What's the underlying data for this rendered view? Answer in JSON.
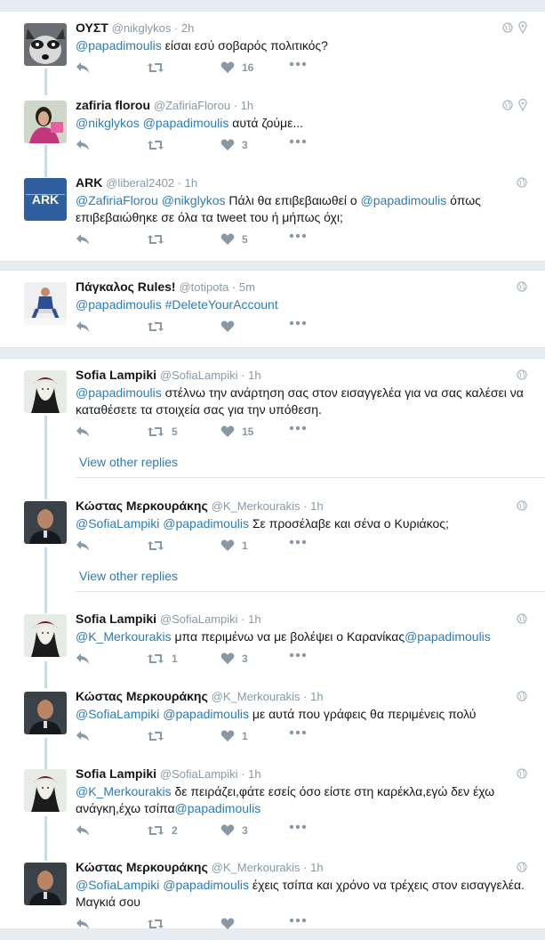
{
  "threads": [
    {
      "tweets": [
        {
          "name": "ΟΥΣΤ",
          "handle": "@nikglykos",
          "time": "2h",
          "body": [
            {
              "t": "@papadimoulis",
              "m": true
            },
            {
              "t": " είσαι εσύ σοβαρός πολιτικός?",
              "m": false
            }
          ],
          "retweets": "",
          "likes": "16",
          "avatar": "raccoon"
        },
        {
          "name": "zafiria florou",
          "handle": "@ZafiriaFlorou",
          "time": "1h",
          "body": [
            {
              "t": "@nikglykos",
              "m": true
            },
            {
              "t": " ",
              "m": false
            },
            {
              "t": "@papadimoulis",
              "m": true
            },
            {
              "t": " αυτά ζούμε...",
              "m": false
            }
          ],
          "retweets": "",
          "likes": "3",
          "avatar": "woman-pink"
        },
        {
          "name": "ARK",
          "handle": "@liberal2402",
          "time": "1h",
          "body": [
            {
              "t": "@ZafiriaFlorou",
              "m": true
            },
            {
              "t": " ",
              "m": false
            },
            {
              "t": "@nikglykos",
              "m": true
            },
            {
              "t": " Πάλι θα επιβεβαιωθεί ο ",
              "m": false
            },
            {
              "t": "@papadimoulis",
              "m": true
            },
            {
              "t": " όπως επιβεβαιώθηκε σε όλα τα tweet του ή μήπως όχι;",
              "m": false
            }
          ],
          "retweets": "",
          "likes": "5",
          "avatar": "ark"
        }
      ]
    },
    {
      "tweets": [
        {
          "name": "Πάγκαλος Rules!",
          "handle": "@totipota",
          "time": "5m",
          "body": [
            {
              "t": "@papadimoulis",
              "m": true
            },
            {
              "t": " ",
              "m": false
            },
            {
              "t": "#DeleteYourAccount",
              "m": true
            }
          ],
          "retweets": "",
          "likes": "",
          "avatar": "man-sitting"
        }
      ]
    },
    {
      "tweets": [
        {
          "name": "Sofia Lampiki",
          "handle": "@SofiaLampiki",
          "time": "1h",
          "body": [
            {
              "t": "@papadimoulis",
              "m": true
            },
            {
              "t": " στέλνω την ανάρτηση σας στον εισαγγελέα για να σας καλέσει να καταθέσετε τα στοιχεία σας για την υπόθεση.",
              "m": false
            }
          ],
          "retweets": "5",
          "likes": "15",
          "avatar": "sofia"
        },
        {
          "name": "Κώστας Μερκουράκης",
          "handle": "@K_Merkourakis",
          "time": "1h",
          "body": [
            {
              "t": "@SofiaLampiki",
              "m": true
            },
            {
              "t": " ",
              "m": false
            },
            {
              "t": "@papadimoulis",
              "m": true
            },
            {
              "t": " Σε προσέλαβε και σένα ο Κυριάκος;",
              "m": false
            }
          ],
          "retweets": "",
          "likes": "1",
          "avatar": "kostas"
        },
        {
          "name": "Sofia Lampiki",
          "handle": "@SofiaLampiki",
          "time": "1h",
          "body": [
            {
              "t": "@K_Merkourakis",
              "m": true
            },
            {
              "t": " μπα περιμένω να με βολέψει ο Καρανίκας",
              "m": false
            },
            {
              "t": "@papadimoulis",
              "m": true
            }
          ],
          "retweets": "1",
          "likes": "3",
          "avatar": "sofia"
        },
        {
          "name": "Κώστας Μερκουράκης",
          "handle": "@K_Merkourakis",
          "time": "1h",
          "body": [
            {
              "t": "@SofiaLampiki",
              "m": true
            },
            {
              "t": " ",
              "m": false
            },
            {
              "t": "@papadimoulis",
              "m": true
            },
            {
              "t": " με αυτά που γράφεις θα περιμένεις πολύ",
              "m": false
            }
          ],
          "retweets": "",
          "likes": "1",
          "avatar": "kostas"
        },
        {
          "name": "Sofia Lampiki",
          "handle": "@SofiaLampiki",
          "time": "1h",
          "body": [
            {
              "t": "@K_Merkourakis",
              "m": true
            },
            {
              "t": " δε πειράζει,φάτε εσείς όσο είστε στη καρέκλα,εγώ δεν έχω ανάγκη,έχω τσίπα",
              "m": false
            },
            {
              "t": "@papadimoulis",
              "m": true
            }
          ],
          "retweets": "2",
          "likes": "3",
          "avatar": "sofia"
        },
        {
          "name": "Κώστας Μερκουράκης",
          "handle": "@K_Merkourakis",
          "time": "1h",
          "body": [
            {
              "t": "@SofiaLampiki",
              "m": true
            },
            {
              "t": " ",
              "m": false
            },
            {
              "t": "@papadimoulis",
              "m": true
            },
            {
              "t": " έχεις τσίπα και χρόνο να τρέχεις στον εισαγγελέα. Μαγκιά σου",
              "m": false
            }
          ],
          "retweets": "",
          "likes": "",
          "avatar": "kostas"
        }
      ]
    }
  ],
  "view_other_replies": "View other replies",
  "colors": {
    "mention": "#2b7bb9",
    "muted": "#8899a6",
    "thread_line": "#c8dbe8",
    "background": "#e6ecf0"
  },
  "icons": [
    "reply-icon",
    "retweet-icon",
    "like-icon",
    "more-icon",
    "globe-icon",
    "location-pin-icon"
  ]
}
